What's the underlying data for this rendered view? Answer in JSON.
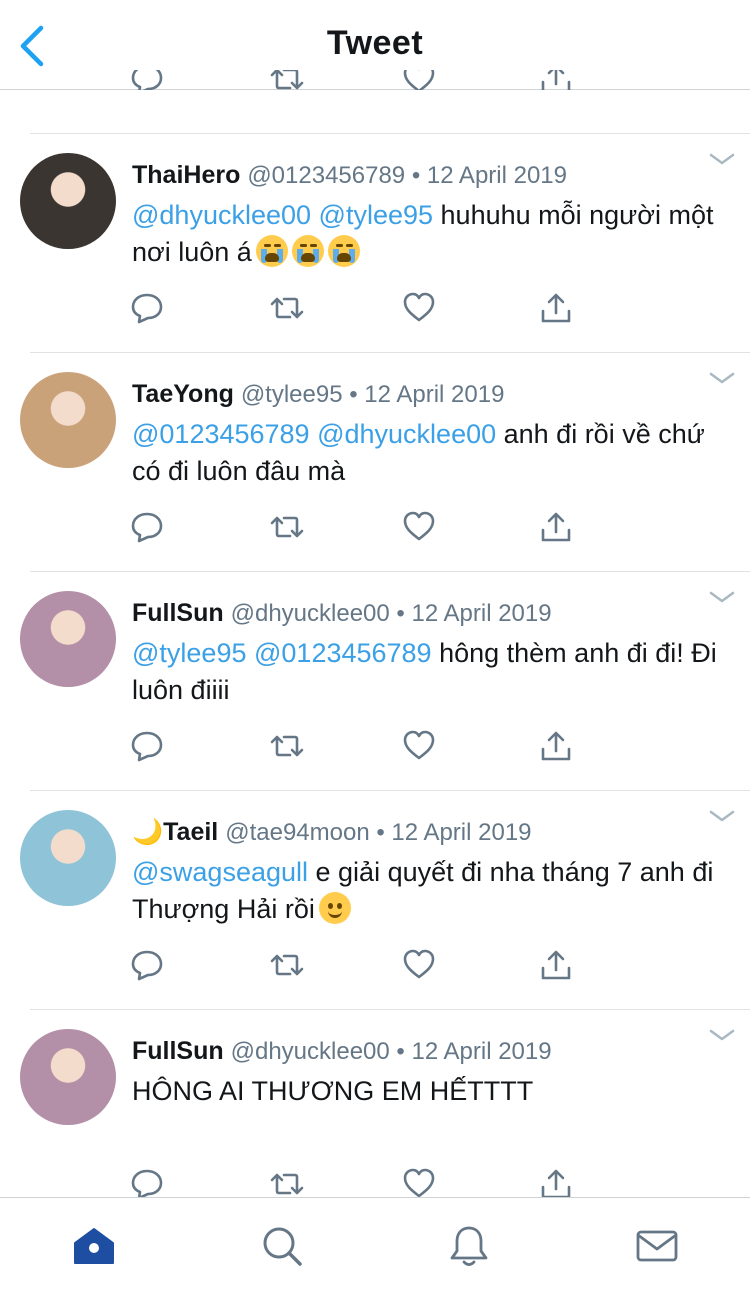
{
  "header": {
    "title": "Tweet"
  },
  "tweets": [
    {
      "name": "ThaiHero",
      "meta": "@0123456789 • 12 April 2019",
      "mentions": [
        "@dhyucklee00",
        "@tylee95"
      ],
      "text": " huhuhu mỗi người một nơi luôn á",
      "emoji": [
        "crying-face-emoji",
        "crying-face-emoji",
        "crying-face-emoji"
      ],
      "avatar_color": "#3a3530"
    },
    {
      "name": "TaeYong",
      "meta": "@tylee95 • 12 April 2019",
      "mentions": [
        "@0123456789",
        "@dhyucklee00"
      ],
      "text": " anh đi rồi về chứ có đi luôn đâu mà",
      "emoji": [],
      "avatar_color": "#c9a27a"
    },
    {
      "name": "FullSun",
      "meta": "@dhyucklee00 • 12 April 2019",
      "mentions": [
        "@tylee95",
        "@0123456789"
      ],
      "text": " hông thèm anh đi đi! Đi luôn điiii",
      "emoji": [],
      "avatar_color": "#b48fa8"
    },
    {
      "name_prefix": "🌙",
      "name": "Taeil",
      "meta": "@tae94moon • 12 April 2019",
      "mentions": [
        "@swagseagull"
      ],
      "text": " e giải quyết đi nha tháng 7 anh đi Thượng Hải rồi",
      "emoji": [
        "slightly-smiling-face-emoji"
      ],
      "avatar_color": "#8fc3d8"
    },
    {
      "name": "FullSun",
      "meta": "@dhyucklee00 • 12 April 2019",
      "mentions": [],
      "text": "HÔNG AI THƯƠNG EM HẾTTTT",
      "emoji": [],
      "avatar_color": "#b48fa8"
    }
  ],
  "colors": {
    "accent": "#1da1f2",
    "mention": "#3ba0e6",
    "icon": "#657786",
    "home_active": "#1d4ea1"
  },
  "tabbar": {
    "items": [
      "home-icon",
      "search-icon",
      "notifications-icon",
      "messages-icon"
    ],
    "active": "home-icon"
  }
}
